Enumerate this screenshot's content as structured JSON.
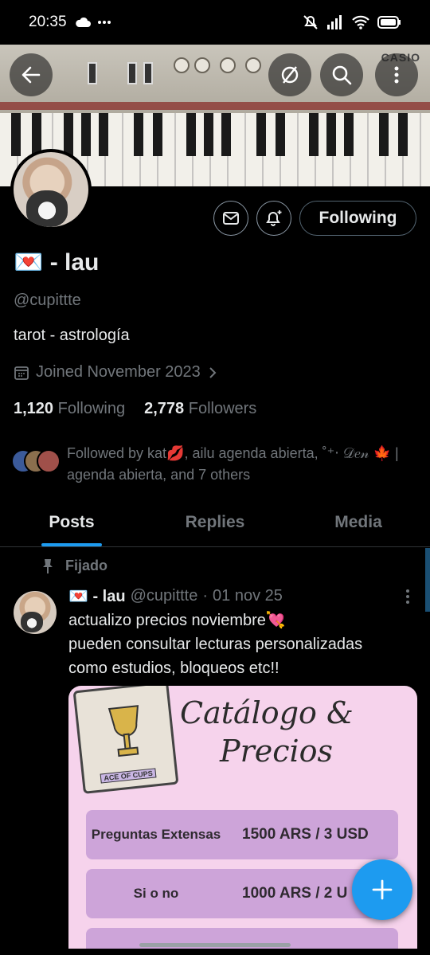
{
  "status_bar": {
    "time": "20:35"
  },
  "profile": {
    "display_name": "💌 - lau",
    "handle": "@cupittte",
    "bio": "tarot - astrología",
    "joined": "Joined November 2023",
    "following_count": "1,120",
    "following_label": "Following",
    "followers_count": "2,778",
    "followers_label": "Followers",
    "followed_by": "Followed by kat💋, ailu agenda abierta, ˚⁺‧ 𝒟𝑒𝓃 🍁 | agenda abierta, and 7 others",
    "follow_button": "Following"
  },
  "tabs": [
    {
      "label": "Posts",
      "active": true
    },
    {
      "label": "Replies",
      "active": false
    },
    {
      "label": "Media",
      "active": false
    }
  ],
  "pinned_label": "Fijado",
  "post": {
    "author": "💌 - lau",
    "handle": "@cupittte",
    "separator": "·",
    "date": "01 nov 25",
    "text_line1": "actualizo precios noviembre💘",
    "text_line2": "pueden consultar lecturas personalizadas",
    "text_line3": "como estudios, bloqueos etc!!"
  },
  "catalog": {
    "title_line1": "Catálogo &",
    "title_line2": "Precios",
    "card_label": "ACE OF CUPS",
    "rows": [
      {
        "label": "Preguntas Extensas",
        "price": "1500 ARS / 3 USD"
      },
      {
        "label": "Si o no",
        "price": "1000 ARS / 2 U"
      }
    ]
  },
  "banner": {
    "brand": "CASIO"
  },
  "colors": {
    "accent": "#1d9bf0",
    "background": "#000000",
    "muted": "#71767b",
    "catalog_bg": "#f6d3ec"
  },
  "icons": {
    "back": "arrow-left-icon",
    "hide": "eye-off-icon",
    "search": "search-icon",
    "more": "more-vertical-icon",
    "message": "mail-icon",
    "notify": "bell-plus-icon",
    "calendar": "calendar-icon",
    "pin": "pin-icon",
    "compose": "plus-icon"
  }
}
